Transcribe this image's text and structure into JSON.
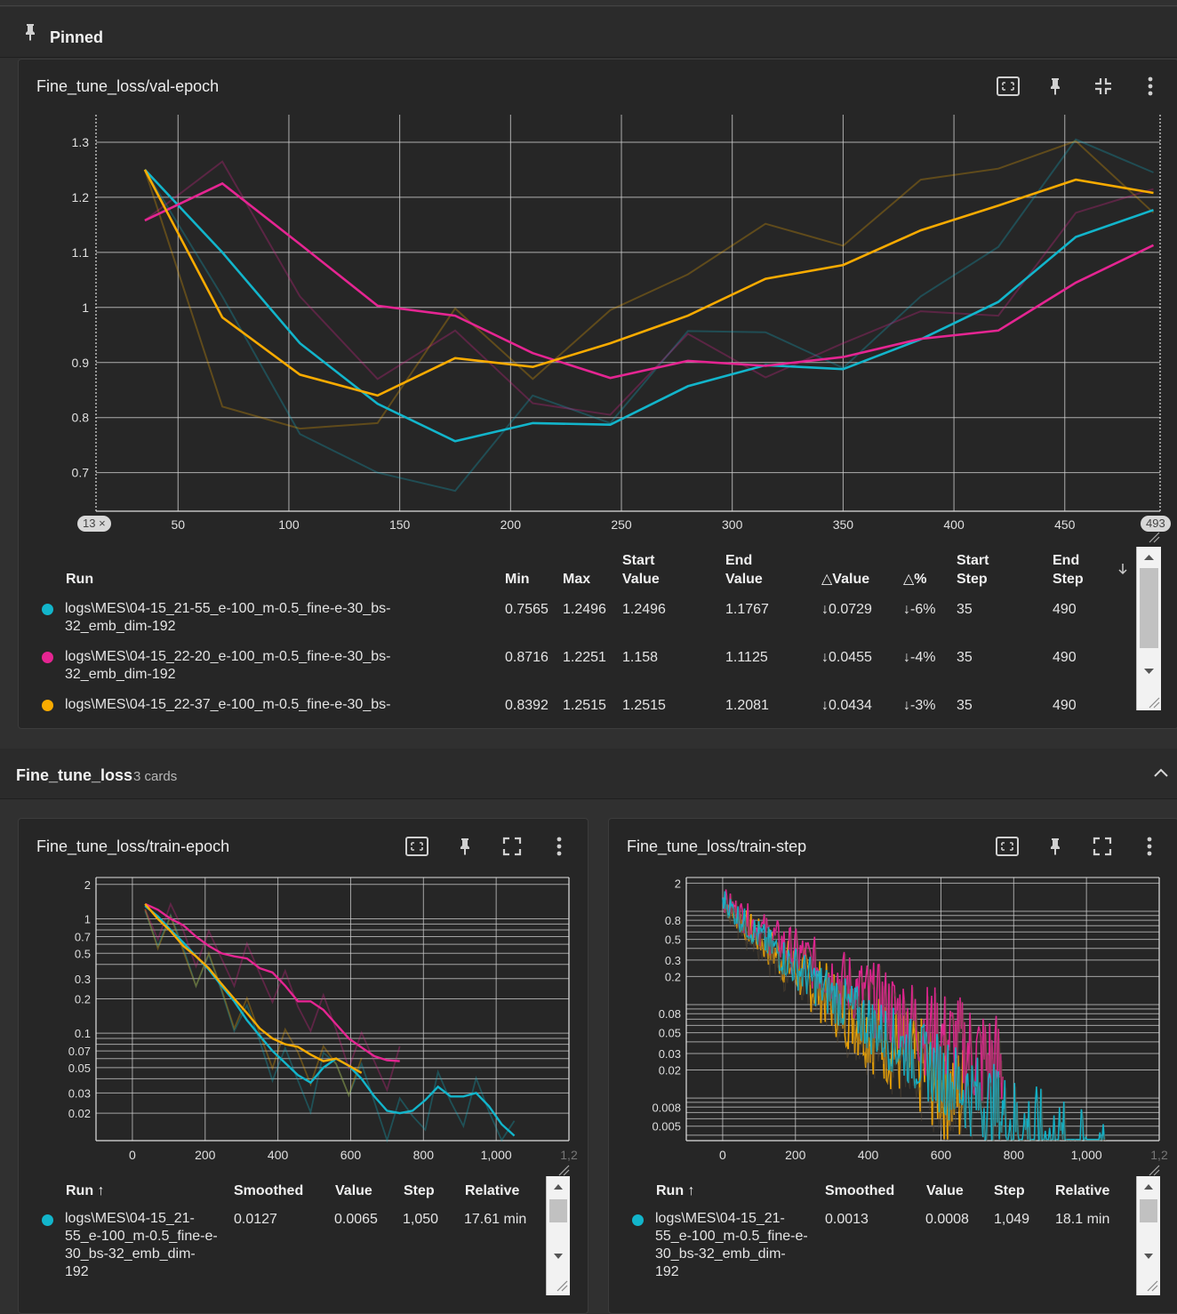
{
  "pinned": {
    "label": "Pinned"
  },
  "val_card": {
    "title": "Fine_tune_loss/val-epoch",
    "chip_left": "13",
    "chip_right": "493",
    "headers": {
      "run": "Run",
      "min": "Min",
      "max": "Max",
      "start_value_1": "Start",
      "start_value_2": "Value",
      "end_value_1": "End",
      "end_value_2": "Value",
      "delta_value": "△Value",
      "delta_pct": "△%",
      "start_step_1": "Start",
      "start_step_2": "Step",
      "end_step_1": "End",
      "end_step_2": "Step"
    },
    "rows": [
      {
        "color": "#12b5cb",
        "name_1": "logs\\MES\\04-15_21-55_e-100_m-0.5_fine-e-30_bs-",
        "name_2": "32_emb_dim-192",
        "min": "0.7565",
        "max": "1.2496",
        "start_value": "1.2496",
        "end_value": "1.1767",
        "delta_value": "↓0.0729",
        "delta_pct": "↓-6%",
        "start_step": "35",
        "end_step": "490"
      },
      {
        "color": "#e52592",
        "name_1": "logs\\MES\\04-15_22-20_e-100_m-0.5_fine-e-30_bs-",
        "name_2": "32_emb_dim-192",
        "min": "0.8716",
        "max": "1.2251",
        "start_value": "1.158",
        "end_value": "1.1125",
        "delta_value": "↓0.0455",
        "delta_pct": "↓-4%",
        "start_step": "35",
        "end_step": "490"
      },
      {
        "color": "#f9ab00",
        "name_1": "logs\\MES\\04-15_22-37_e-100_m-0.5_fine-e-30_bs-",
        "name_2": "",
        "min": "0.8392",
        "max": "1.2515",
        "start_value": "1.2515",
        "end_value": "1.2081",
        "delta_value": "↓0.0434",
        "delta_pct": "↓-3%",
        "start_step": "35",
        "end_step": "490"
      }
    ]
  },
  "group": {
    "name": "Fine_tune_loss",
    "count": "3 cards"
  },
  "train_epoch_card": {
    "title": "Fine_tune_loss/train-epoch",
    "headers": {
      "run": "Run ↑",
      "smoothed": "Smoothed",
      "value": "Value",
      "step": "Step",
      "relative": "Relative"
    },
    "row": {
      "color": "#12b5cb",
      "name_1": "logs\\MES\\04-15_21-",
      "name_2": "55_e-100_m-0.5_fine-e-",
      "name_3": "30_bs-32_emb_dim-",
      "name_4": "192",
      "smoothed": "0.0127",
      "value": "0.0065",
      "step": "1,050",
      "relative": "17.61 min"
    }
  },
  "train_step_card": {
    "title": "Fine_tune_loss/train-step",
    "headers": {
      "run": "Run ↑",
      "smoothed": "Smoothed",
      "value": "Value",
      "step": "Step",
      "relative": "Relative"
    },
    "row": {
      "color": "#12b5cb",
      "name_1": "logs\\MES\\04-15_21-",
      "name_2": "55_e-100_m-0.5_fine-e-",
      "name_3": "30_bs-32_emb_dim-",
      "name_4": "192",
      "smoothed": "0.0013",
      "value": "0.0008",
      "step": "1,049",
      "relative": "18.1 min"
    }
  },
  "colors": {
    "cyan": "#12b5cb",
    "magenta": "#e52592",
    "orange": "#f9ab00"
  },
  "icons": [
    "pin-icon",
    "fit-domain-icon",
    "pin-card-icon",
    "collapse-icon",
    "expand-icon",
    "more-vert-icon",
    "chevron-up-icon",
    "sort-arrow-icon"
  ],
  "chart_data": [
    {
      "type": "line",
      "ylim": [
        0.63,
        1.35
      ],
      "yticks": [
        "0.7",
        "0.8",
        "0.9",
        "1",
        "1.1",
        "1.2",
        "1.3"
      ],
      "xticks": [
        "50",
        "100",
        "150",
        "200",
        "250",
        "300",
        "350",
        "400",
        "450"
      ],
      "xlim": [
        13,
        493
      ],
      "series": [
        {
          "color": "#12b5cb",
          "x": [
            35,
            70,
            105,
            140,
            175,
            210,
            245,
            280,
            315,
            350,
            385,
            420,
            455,
            490
          ],
          "smoothed": [
            1.25,
            1.1,
            0.935,
            0.825,
            0.757,
            0.79,
            0.787,
            0.857,
            0.895,
            0.888,
            0.942,
            1.01,
            1.128,
            1.177
          ],
          "raw": [
            1.25,
            1.02,
            0.77,
            0.7,
            0.667,
            0.84,
            0.79,
            0.957,
            0.955,
            0.89,
            1.02,
            1.11,
            1.305,
            1.245
          ]
        },
        {
          "color": "#e52592",
          "x": [
            35,
            70,
            105,
            140,
            175,
            210,
            245,
            280,
            315,
            350,
            385,
            420,
            455,
            490
          ],
          "smoothed": [
            1.158,
            1.225,
            1.115,
            1.003,
            0.985,
            0.917,
            0.872,
            0.903,
            0.894,
            0.91,
            0.943,
            0.958,
            1.045,
            1.113
          ],
          "raw": [
            1.158,
            1.265,
            1.02,
            0.87,
            0.958,
            0.826,
            0.805,
            0.952,
            0.873,
            0.935,
            0.993,
            0.985,
            1.172,
            1.215
          ]
        },
        {
          "color": "#f9ab00",
          "x": [
            35,
            70,
            105,
            140,
            175,
            210,
            245,
            280,
            315,
            350,
            385,
            420,
            455,
            490
          ],
          "smoothed": [
            1.25,
            0.982,
            0.878,
            0.84,
            0.908,
            0.892,
            0.935,
            0.985,
            1.052,
            1.077,
            1.14,
            1.185,
            1.232,
            1.208
          ],
          "raw": [
            1.25,
            0.82,
            0.78,
            0.79,
            0.998,
            0.87,
            0.995,
            1.06,
            1.152,
            1.112,
            1.232,
            1.252,
            1.302,
            1.172
          ]
        }
      ]
    },
    {
      "type": "line",
      "yscale": "log",
      "yticks": [
        "2",
        "1",
        "0.7",
        "0.5",
        "0.3",
        "0.2",
        "0.1",
        "0.07",
        "0.05",
        "0.03",
        "0.02"
      ],
      "xticks": [
        "0",
        "200",
        "400",
        "600",
        "800",
        "1,000",
        "1,2"
      ],
      "xlim": [
        -100,
        1200
      ],
      "series": [
        {
          "color": "#12b5cb",
          "x": [
            35,
            70,
            105,
            140,
            175,
            210,
            245,
            280,
            315,
            350,
            385,
            420,
            455,
            490,
            525,
            560,
            595,
            630,
            665,
            700,
            735,
            770,
            805,
            840,
            875,
            910,
            945,
            980,
            1015,
            1050
          ],
          "y": [
            1.3,
            1.05,
            0.8,
            0.62,
            0.47,
            0.36,
            0.26,
            0.19,
            0.13,
            0.095,
            0.07,
            0.055,
            0.043,
            0.037,
            0.05,
            0.06,
            0.052,
            0.04,
            0.028,
            0.021,
            0.02,
            0.021,
            0.026,
            0.034,
            0.028,
            0.028,
            0.03,
            0.023,
            0.016,
            0.0127
          ]
        },
        {
          "color": "#e52592",
          "x": [
            35,
            70,
            105,
            140,
            175,
            210,
            245,
            280,
            315,
            350,
            385,
            420,
            455,
            490,
            525,
            560,
            595,
            630,
            665,
            700,
            735
          ],
          "y": [
            1.35,
            1.2,
            1.0,
            0.88,
            0.7,
            0.58,
            0.5,
            0.47,
            0.45,
            0.37,
            0.34,
            0.26,
            0.19,
            0.19,
            0.16,
            0.12,
            0.09,
            0.075,
            0.063,
            0.058,
            0.057
          ]
        },
        {
          "color": "#f9ab00",
          "x": [
            35,
            70,
            105,
            140,
            175,
            210,
            245,
            280,
            315,
            350,
            385,
            420,
            455,
            490,
            525,
            560,
            595,
            630
          ],
          "y": [
            1.35,
            1.0,
            0.78,
            0.58,
            0.47,
            0.37,
            0.27,
            0.2,
            0.15,
            0.11,
            0.09,
            0.08,
            0.076,
            0.065,
            0.057,
            0.06,
            0.052,
            0.045
          ]
        }
      ]
    },
    {
      "type": "line",
      "yscale": "log",
      "yticks": [
        "2",
        "0.8",
        "0.5",
        "0.3",
        "0.2",
        "0.08",
        "0.05",
        "0.03",
        "0.02",
        "0.008",
        "0.005"
      ],
      "xticks": [
        "0",
        "200",
        "400",
        "600",
        "800",
        "1,000",
        "1,2"
      ],
      "xlim": [
        -100,
        1200
      ],
      "series": [
        {
          "color": "#f9ab00",
          "x_range": [
            0,
            660
          ],
          "y_start": 1.4,
          "y_end": 0.01
        },
        {
          "color": "#e52592",
          "x_range": [
            0,
            770
          ],
          "y_start": 1.4,
          "y_end": 0.02
        },
        {
          "color": "#12b5cb",
          "x_range": [
            0,
            1049
          ],
          "y_start": 1.4,
          "y_end": 0.0013
        }
      ]
    }
  ]
}
